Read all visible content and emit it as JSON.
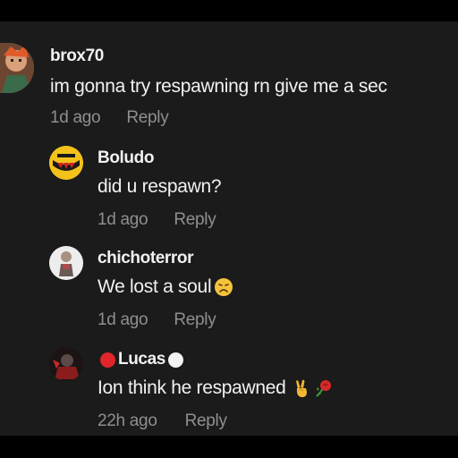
{
  "comments": [
    {
      "username": "brox70",
      "text": "im gonna try respawning rn give me a sec",
      "time": "1d ago",
      "reply": "Reply",
      "avatar_icon": "anime-character-avatar-icon"
    },
    {
      "username": "Boludo",
      "text": "did u respawn?",
      "time": "1d ago",
      "reply": "Reply",
      "avatar_icon": "yellow-emoji-avatar-icon"
    },
    {
      "username": "chichoterror",
      "text": "We lost a soul",
      "time": "1d ago",
      "reply": "Reply",
      "avatar_icon": "figure-avatar-icon",
      "trailing_icon": "sad-face-emoji-icon"
    },
    {
      "username": "Lucas",
      "text": "Ion think he respawned",
      "time": "22h ago",
      "reply": "Reply",
      "avatar_icon": "dark-red-avatar-icon",
      "leading_badge": "red-circle-icon",
      "trailing_badge": "white-circle-icon",
      "trailing_icons": [
        "victory-hand-emoji-icon",
        "rose-emoji-icon"
      ]
    }
  ],
  "colors": {
    "background": "#1b1b1b",
    "frame": "#000000",
    "primary_text": "#f1f1f1",
    "secondary_text": "#8f8f8f",
    "red_badge": "#e0262b",
    "white_badge": "#f2f2f2"
  }
}
